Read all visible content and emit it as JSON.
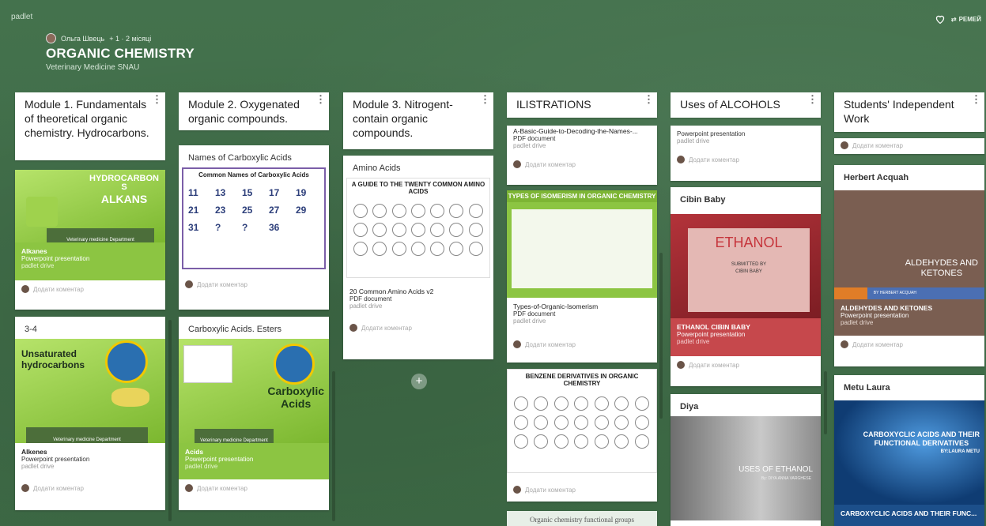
{
  "app": {
    "brand": "padlet",
    "remix_label": "РЕМЕЙ"
  },
  "author": {
    "name": "Ольга Швець",
    "meta": "+ 1 · 2 місяці"
  },
  "board": {
    "title": "ORGANIC CHEMISTRY",
    "subtitle": "Veterinary Medicine SNAU"
  },
  "comment_label": "Додати коментар",
  "columns": [
    {
      "title": "Module 1. Fundamentals of theoretical organic chemistry. Hydrocarbons.",
      "posts": [
        {
          "thumb_text": [
            "HYDROCARBON",
            "S",
            "ALKANS"
          ],
          "banner": "Veterinary medicine Department",
          "name": "Alkanes",
          "type": "Powerpoint presentation",
          "src": "padlet drive"
        },
        {
          "title": "3-4",
          "thumb_text": [
            "Unsaturated",
            "hydrocarbons"
          ],
          "banner": "Veterinary medicine Department",
          "name": "Alkenes",
          "type": "Powerpoint presentation",
          "src": "padlet drive"
        }
      ]
    },
    {
      "title": "Module 2. Oxygenated organic compounds.",
      "posts": [
        {
          "title": "Names of Carboxylic Acids",
          "chart_title": "Common Names of Carboxylic Acids",
          "numbers": [
            "11",
            "13",
            "15",
            "17",
            "19",
            "21",
            "23",
            "25",
            "27",
            "29",
            "31",
            "?",
            "?",
            "36"
          ]
        },
        {
          "title": "Carboxylic Acids. Esters",
          "thumb_text": [
            "Carboxylic",
            "Acids"
          ],
          "banner": "Veterinary medicine Department",
          "name": "Acids",
          "type": "Powerpoint presentation",
          "src": "padlet drive"
        }
      ]
    },
    {
      "title": "Module 3. Nitrogent-contain organic compounds.",
      "posts": [
        {
          "title": "Amino Acids",
          "chart_title": "A GUIDE TO THE TWENTY COMMON AMINO ACIDS",
          "name": "20 Common Amino Acids v2",
          "type": "PDF document",
          "src": "padlet drive"
        }
      ]
    },
    {
      "title": "ILISTRATIONS",
      "posts": [
        {
          "name": "A-Basic-Guide-to-Decoding-the-Names-...",
          "type": "PDF document",
          "src": "padlet drive"
        },
        {
          "chart_title": "TYPES OF ISOMERISM IN ORGANIC CHEMISTRY",
          "name": "Types-of-Organic-Isomerism",
          "type": "PDF document",
          "src": "padlet drive"
        },
        {
          "chart_title": "BENZENE DERIVATIVES IN ORGANIC CHEMISTRY"
        },
        {
          "partial_title": "Organic chemistry functional groups"
        }
      ]
    },
    {
      "title": "Uses of ALCOHOLS",
      "posts": [
        {
          "type": "Powerpoint presentation",
          "src": "padlet drive"
        },
        {
          "title": "Cibin Baby",
          "thumb_text": [
            "ETHANOL",
            "SUBMITTED BY",
            "CIBIN BABY"
          ],
          "name": "ETHANOL CIBIN BABY",
          "type": "Powerpoint presentation",
          "src": "padlet drive"
        },
        {
          "title": "Diya",
          "thumb_text": [
            "USES OF ETHANOL",
            "By: DIYA ANNA VARGHESE"
          ]
        }
      ]
    },
    {
      "title": "Students' Independent Work",
      "posts": [
        {
          "title": "Herbert Acquah",
          "thumb_text": [
            "ALDEHYDES AND",
            "KETONES",
            "BY HERBERT ACQUAH"
          ],
          "name": "ALDEHYDES AND KETONES",
          "type": "Powerpoint presentation",
          "src": "padlet drive"
        },
        {
          "title": "Metu Laura",
          "thumb_text": [
            "CARBOXYCLIC ACIDS AND THEIR",
            "FUNCTIONAL DERIVATIVES",
            "BY:LAURA METU"
          ],
          "name": "CARBOXYCLIC ACIDS AND THEIR FUNC..."
        }
      ]
    }
  ],
  "colors": {
    "board_bg": "#3f6b47",
    "green_accent": "#8cc542",
    "red_accent": "#c6484c",
    "brown_accent": "#7a5e51",
    "blue_accent": "#1c4f8a"
  }
}
